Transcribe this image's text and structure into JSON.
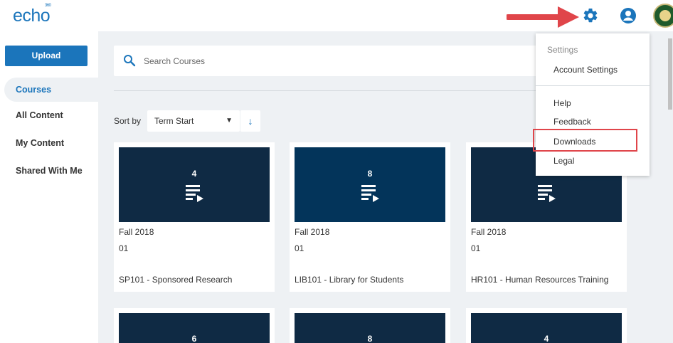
{
  "header": {
    "logo": "echo",
    "logo_sup": "360"
  },
  "sidebar": {
    "upload_label": "Upload",
    "items": [
      {
        "label": "Courses",
        "active": true
      },
      {
        "label": "All Content",
        "active": false
      },
      {
        "label": "My Content",
        "active": false
      },
      {
        "label": "Shared With Me",
        "active": false
      }
    ]
  },
  "search": {
    "placeholder": "Search Courses"
  },
  "sort": {
    "label": "Sort by",
    "value": "Term Start",
    "direction_glyph": "↓"
  },
  "courses": [
    {
      "count": "4",
      "term": "Fall 2018",
      "section": "01",
      "title": "SP101 - Sponsored Research"
    },
    {
      "count": "8",
      "term": "Fall 2018",
      "section": "01",
      "title": "LIB101 - Library for Students"
    },
    {
      "count": "",
      "term": "Fall 2018",
      "section": "01",
      "title": "HR101 - Human Resources Training"
    },
    {
      "count": "6"
    },
    {
      "count": "8"
    },
    {
      "count": "4"
    }
  ],
  "dropdown": {
    "header": "Settings",
    "items": [
      "Account Settings",
      "Help",
      "Feedback",
      "Downloads",
      "Legal"
    ]
  },
  "colors": {
    "accent": "#1b75bb",
    "thumb": "#0f2a44",
    "highlight": "#e0454a"
  }
}
